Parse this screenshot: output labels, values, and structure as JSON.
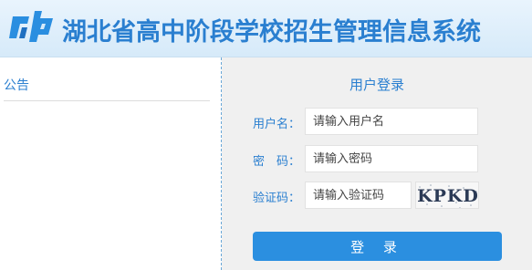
{
  "header": {
    "logo_icon": "cp-logo-icon",
    "title": "湖北省高中阶段学校招生管理信息系统"
  },
  "notice": {
    "title": "公告"
  },
  "login": {
    "heading": "用户登录",
    "username_label": "用户名：",
    "username_placeholder": "请输入用户名",
    "password_label": "密　码：",
    "password_placeholder": "请输入密码",
    "captcha_label": "验证码：",
    "captcha_placeholder": "请输入验证码",
    "captcha_text": "KPKD",
    "submit_label": "登 录"
  },
  "colors": {
    "accent": "#2a7fd0",
    "button": "#2b8fe0",
    "header_bg": "#d6eaf9",
    "panel_bg": "#f0f0f0"
  }
}
